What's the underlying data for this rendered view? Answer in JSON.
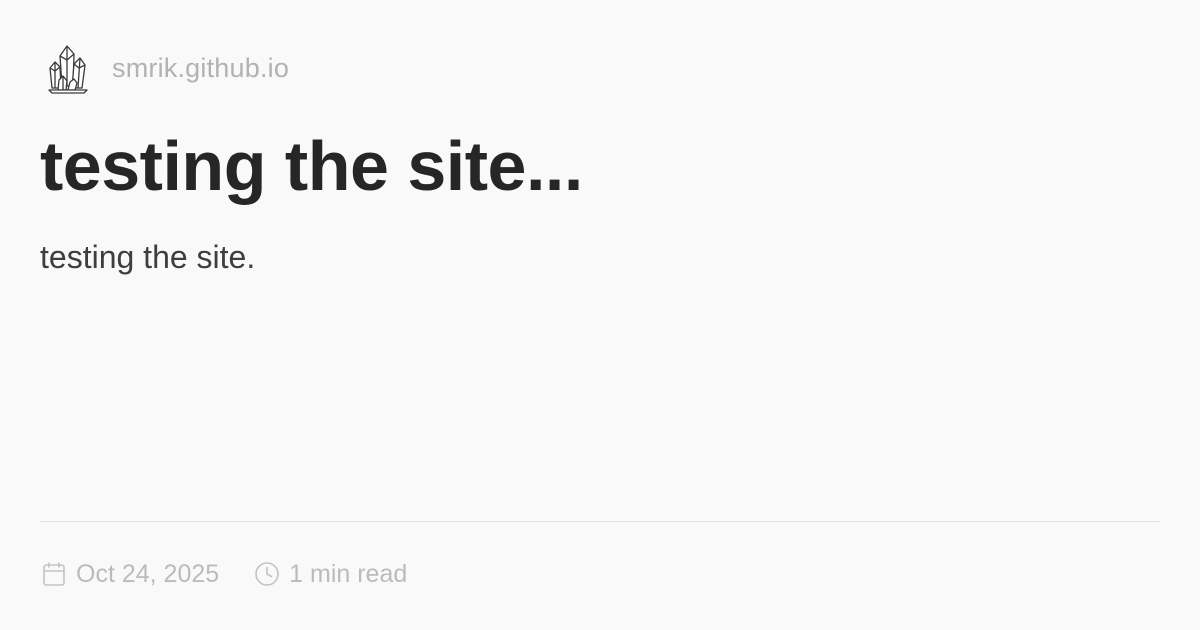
{
  "site": {
    "name": "smrik.github.io",
    "logo_icon": "crystal-cluster-icon"
  },
  "post": {
    "title": "testing the site...",
    "description": "testing the site."
  },
  "meta": {
    "date": "Oct 24, 2025",
    "date_icon": "calendar-icon",
    "reading_time": "1 min read",
    "reading_time_icon": "clock-icon"
  },
  "colors": {
    "background": "#faf9fa",
    "title": "#272626",
    "description": "#3f3d3e",
    "muted": "#b3b1b3",
    "divider": "#e6e4e6"
  }
}
